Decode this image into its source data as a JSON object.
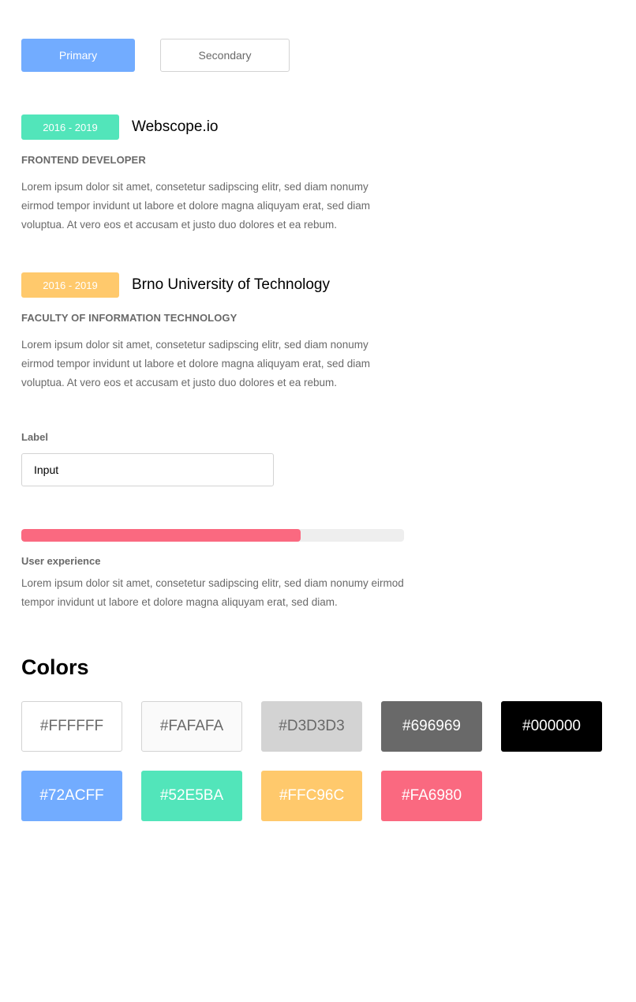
{
  "buttons": {
    "primary_label": "Primary",
    "secondary_label": "Secondary"
  },
  "experience": [
    {
      "dates": "2016 - 2019",
      "badge_color": "#52E5BA",
      "title": "Webscope.io",
      "subtitle": "FRONTEND DEVELOPER",
      "description": "Lorem ipsum dolor sit amet, consetetur sadipscing elitr, sed diam nonumy eirmod tempor invidunt ut labore et dolore magna aliquyam erat, sed diam voluptua. At vero eos et accusam et justo duo dolores et ea rebum."
    },
    {
      "dates": "2016 - 2019",
      "badge_color": "#FFC96C",
      "title": "Brno University of Technology",
      "subtitle": "FACULTY OF INFORMATION TECHNOLOGY",
      "description": "Lorem ipsum dolor sit amet, consetetur sadipscing elitr, sed diam nonumy eirmod tempor invidunt ut labore et dolore magna aliquyam erat, sed diam voluptua. At vero eos et accusam et justo duo dolores et ea rebum."
    }
  ],
  "form": {
    "label": "Label",
    "input_value": "Input"
  },
  "skill": {
    "progress_percent": 73,
    "label": "User experience",
    "description": "Lorem ipsum dolor sit amet, consetetur sadipscing elitr, sed diam nonumy eirmod tempor invidunt ut labore et dolore magna aliquyam erat, sed diam."
  },
  "colors": {
    "heading": "Colors",
    "swatches": [
      {
        "label": "#FFFFFF",
        "bg": "#FFFFFF",
        "fg": "#696969",
        "border": "#D3D3D3"
      },
      {
        "label": "#FAFAFA",
        "bg": "#FAFAFA",
        "fg": "#696969",
        "border": "#D3D3D3"
      },
      {
        "label": "#D3D3D3",
        "bg": "#D3D3D3",
        "fg": "#696969",
        "border": ""
      },
      {
        "label": "#696969",
        "bg": "#696969",
        "fg": "#FFFFFF",
        "border": ""
      },
      {
        "label": "#000000",
        "bg": "#000000",
        "fg": "#FFFFFF",
        "border": ""
      },
      {
        "label": "#72ACFF",
        "bg": "#72ACFF",
        "fg": "#FFFFFF",
        "border": ""
      },
      {
        "label": "#52E5BA",
        "bg": "#52E5BA",
        "fg": "#FFFFFF",
        "border": ""
      },
      {
        "label": "#FFC96C",
        "bg": "#FFC96C",
        "fg": "#FFFFFF",
        "border": ""
      },
      {
        "label": "#FA6980",
        "bg": "#FA6980",
        "fg": "#FFFFFF",
        "border": ""
      }
    ]
  }
}
